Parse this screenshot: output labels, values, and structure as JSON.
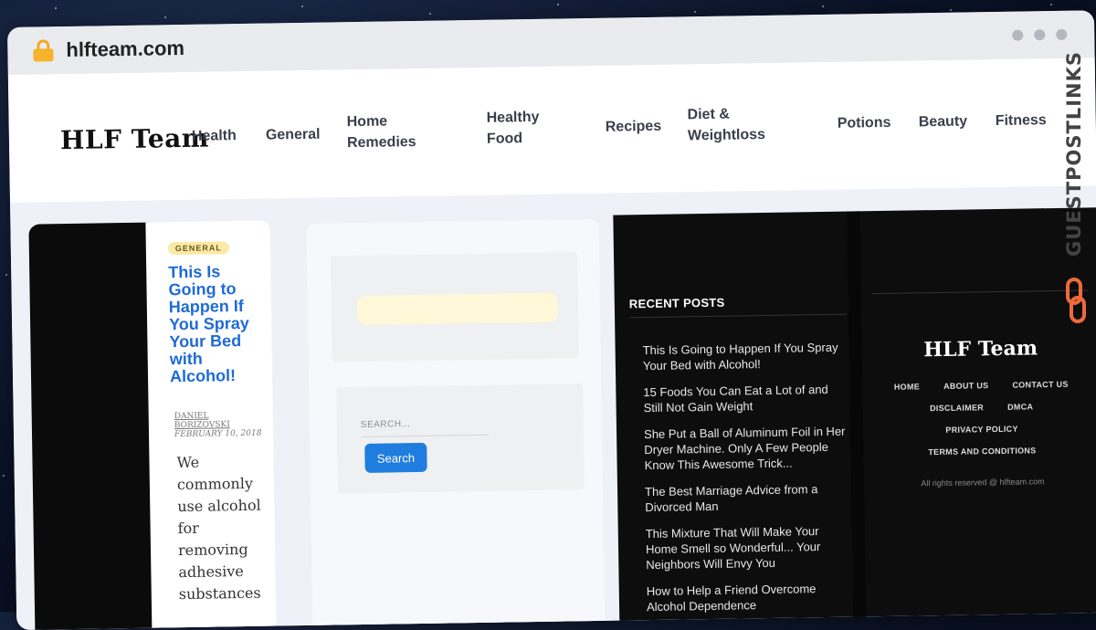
{
  "browser": {
    "url": "hlfteam.com"
  },
  "header": {
    "logo": "HLF Team",
    "nav": [
      {
        "label": "Health"
      },
      {
        "label": "General"
      },
      {
        "label": "Home Remedies"
      },
      {
        "label": "Healthy Food"
      },
      {
        "label": "Recipes"
      },
      {
        "label": "Diet & Weightloss"
      },
      {
        "label": "Potions"
      },
      {
        "label": "Beauty"
      },
      {
        "label": "Fitness"
      }
    ]
  },
  "post": {
    "category": "GENERAL",
    "title": "This Is Going to Happen If You Spray Your Bed with Alcohol!",
    "author": "DANIEL BORIZOVSKI",
    "date": "FEBRUARY 10, 2018",
    "excerpt": "We commonly use alcohol for removing adhesive substances"
  },
  "search": {
    "placeholder": "SEARCH...",
    "button_label": "Search"
  },
  "recent_posts": {
    "heading": "RECENT POSTS",
    "items": [
      "This Is Going to Happen If You Spray Your Bed with Alcohol!",
      "15 Foods You Can Eat a Lot of and Still Not Gain Weight",
      "She Put a Ball of Aluminum Foil in Her Dryer Machine. Only A Few People Know This Awesome Trick...",
      "The Best Marriage Advice from a Divorced Man",
      "This Mixture That Will Make Your Home Smell so Wonderful... Your Neighbors Will Envy You",
      "How to Help a Friend Overcome Alcohol Dependence"
    ]
  },
  "footer": {
    "logo": "HLF Team",
    "links": [
      "HOME",
      "ABOUT US",
      "CONTACT US",
      "DISCLAIMER",
      "DMCA",
      "PRIVACY POLICY",
      "TERMS AND CONDITIONS"
    ],
    "copyright": "All rights reserved @ hlfteam.com"
  },
  "watermark": {
    "text": "GUESTPOSTLINKS"
  },
  "colors": {
    "accent_blue": "#1e6bd6",
    "button_blue": "#1f7de0",
    "lock_orange": "#f7b32b",
    "badge_yellow": "#fbe9a8",
    "watermark_orange": "#ee6a3b"
  },
  "icons": {
    "lock": "lock-icon",
    "watermark": "chain-link-icon"
  }
}
